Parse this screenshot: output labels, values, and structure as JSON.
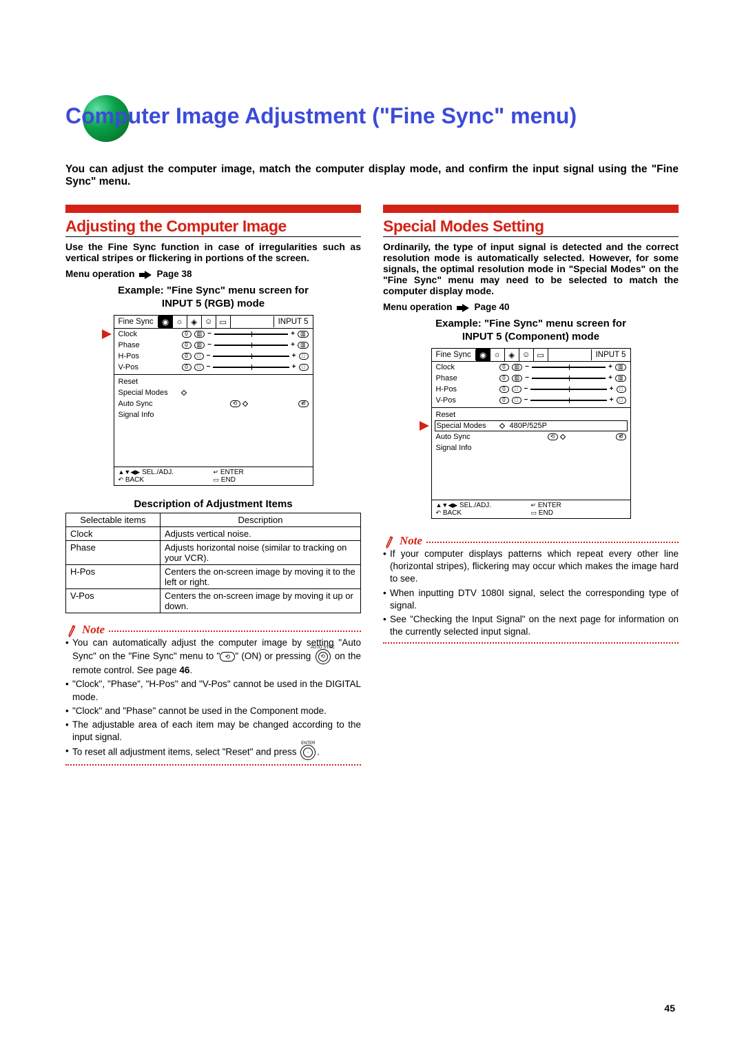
{
  "page_number": "45",
  "title": "Computer Image Adjustment (\"Fine Sync\" menu)",
  "intro": "You can adjust the computer image, match the computer display mode, and confirm the input signal using the \"Fine Sync\" menu.",
  "left": {
    "heading": "Adjusting the Computer Image",
    "para": "Use the Fine Sync function in case of irregularities such as vertical stripes or flickering in portions of the screen.",
    "menu_op_prefix": "Menu operation",
    "menu_op_page": "Page 38",
    "example_caption_l1": "Example: \"Fine Sync\" menu screen for",
    "example_caption_l2": "INPUT 5 (RGB) mode",
    "desc_caption": "Description of Adjustment Items",
    "table": {
      "headers": [
        "Selectable items",
        "Description"
      ],
      "rows": [
        [
          "Clock",
          "Adjusts vertical noise."
        ],
        [
          "Phase",
          "Adjusts horizontal noise (similar to tracking on your VCR)."
        ],
        [
          "H-Pos",
          "Centers the on-screen image by moving it to the left or right."
        ],
        [
          "V-Pos",
          "Centers the on-screen image by moving it up or down."
        ]
      ]
    },
    "note_label": "Note",
    "notes": [
      {
        "pre": "You can automatically adjust the computer image by setting \"Auto Sync\" on the \"Fine Sync\" menu to \"",
        "iconA": "sync-on-icon",
        "mid": "\" (ON) or pressing ",
        "btn": "AUTO SYNC",
        "post": " on the remote control. See page ",
        "page": "46",
        "end": "."
      },
      {
        "text": "\"Clock\", \"Phase\", \"H-Pos\" and \"V-Pos\" cannot be used in the DIGITAL mode."
      },
      {
        "text": "\"Clock\" and \"Phase\" cannot be used in the Component mode."
      },
      {
        "text": "The adjustable area of each item may be changed according to the input signal."
      },
      {
        "pre": "To reset all adjustment items, select \"Reset\" and press ",
        "btn": "ENTER",
        "post": "."
      }
    ]
  },
  "right": {
    "heading": "Special Modes Setting",
    "para": "Ordinarily, the type of input signal is detected and the correct resolution mode is automatically selected. However, for some signals, the optimal resolution mode in \"Special Modes\" on the \"Fine Sync\" menu may need to be selected to match the computer display mode.",
    "menu_op_prefix": "Menu operation",
    "menu_op_page": "Page 40",
    "example_caption_l1": "Example: \"Fine Sync\" menu screen for",
    "example_caption_l2": "INPUT 5 (Component) mode",
    "special_value": "480P/525P",
    "note_label": "Note",
    "notes": [
      "If your computer displays patterns which repeat every other line (horizontal stripes), flickering may occur which makes the image hard to see.",
      "When inputting DTV 1080I signal, select the corresponding type of signal.",
      "See \"Checking the Input Signal\" on the next page for information on the currently selected input signal."
    ]
  },
  "osd": {
    "title": "Fine Sync",
    "input_label": "INPUT 5",
    "rows_slider": [
      "Clock",
      "Phase",
      "H-Pos",
      "V-Pos"
    ],
    "row_reset": "Reset",
    "row_special": "Special Modes",
    "row_auto": "Auto Sync",
    "row_signal": "Signal Info",
    "slider_value": "0",
    "footer": {
      "sel": "SEL./ADJ.",
      "enter": "ENTER",
      "back": "BACK",
      "end": "END"
    }
  }
}
